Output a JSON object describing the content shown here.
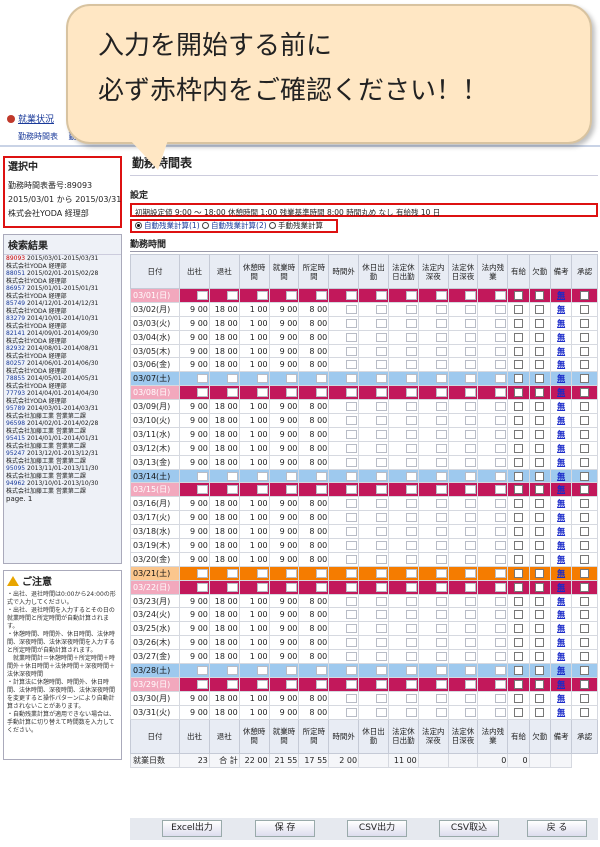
{
  "callout": {
    "line1": "入力を開始する前に",
    "line2": "必ず赤枠内をご確認ください！！"
  },
  "nav": {
    "top_status": "就業状況",
    "breadcrumb": [
      "勤務時間表",
      "勤務予定"
    ]
  },
  "selected": {
    "title": "選択中",
    "number": "勤務時間表番号:89093",
    "period": "2015/03/01 から 2015/03/31",
    "company": "株式会社YODA 経理部"
  },
  "search": {
    "title": "検索結果",
    "page": "page. 1",
    "items": [
      {
        "id": "89093",
        "period": "2015/03/01-2015/03/31",
        "org": "株式会社YODA 経理部",
        "red": true
      },
      {
        "id": "88051",
        "period": "2015/02/01-2015/02/28",
        "org": "株式会社YODA 経理部",
        "red": false
      },
      {
        "id": "86957",
        "period": "2015/01/01-2015/01/31",
        "org": "株式会社YODA 経理部",
        "red": false
      },
      {
        "id": "85749",
        "period": "2014/12/01-2014/12/31",
        "org": "株式会社YODA 経理部",
        "red": false
      },
      {
        "id": "83279",
        "period": "2014/10/01-2014/10/31",
        "org": "株式会社YODA 経理部",
        "red": false
      },
      {
        "id": "82141",
        "period": "2014/09/01-2014/09/30",
        "org": "株式会社YODA 経理部",
        "red": false
      },
      {
        "id": "82932",
        "period": "2014/08/01-2014/08/31",
        "org": "株式会社YODA 経理部",
        "red": false
      },
      {
        "id": "80257",
        "period": "2014/06/01-2014/06/30",
        "org": "株式会社YODA 経理部",
        "red": false
      },
      {
        "id": "78855",
        "period": "2014/05/01-2014/05/31",
        "org": "株式会社YODA 経理部",
        "red": false
      },
      {
        "id": "77793",
        "period": "2014/04/01-2014/04/30",
        "org": "株式会社YODA 経理部",
        "red": false
      },
      {
        "id": "95789",
        "period": "2014/03/01-2014/03/31",
        "org": "株式会社加藤工業 営業第二課",
        "red": false
      },
      {
        "id": "96598",
        "period": "2014/02/01-2014/02/28",
        "org": "株式会社加藤工業 営業第二課",
        "red": false
      },
      {
        "id": "95415",
        "period": "2014/01/01-2014/01/31",
        "org": "株式会社加藤工業 営業第二課",
        "red": false
      },
      {
        "id": "95247",
        "period": "2013/12/01-2013/12/31",
        "org": "株式会社加藤工業 営業第二課",
        "red": false
      },
      {
        "id": "95095",
        "period": "2013/11/01-2013/11/30",
        "org": "株式会社加藤工業 営業第二課",
        "red": false
      },
      {
        "id": "94962",
        "period": "2013/10/01-2013/10/30",
        "org": "株式会社加藤工業 営業第二課",
        "red": false
      }
    ]
  },
  "notice": {
    "title": "ご注意",
    "lines": [
      "・出社、退社時間は0:00から24:00の形式で入力してください。",
      "・出社、退社時間を入力するとその日の就業時間と所定時間が自動計算されます。",
      "・休憩時間、時間外、休日時間、法休時間、深夜時間、法休深夜時間を入力すると所定時間が自動計算されます。",
      "　就業時間計＝休憩時間＋所定時間＋時間外＋休日時間＋法休時間＋深夜時間＋法休深夜時間",
      "・計算法に休憩時間、時間外、休日時間、法休時間、深夜時間、法休深夜時間を変更すると操作パターンにより自動計算されないことがあります。",
      "・自動残業計算が適用できない場合は、手動計算に切り替えて時間数を入力してください。"
    ]
  },
  "page_title": "勤務時間表",
  "settings": {
    "title": "設定",
    "config": "初期設定値  9:00 〜 18:00 休憩時間 1:00 残業基準時間  8:00 時間丸め なし  有給残 10 日",
    "radio1": "自動残業計算(1)",
    "radio2": "自動残業計算(2)",
    "radio3": "手動残業計算"
  },
  "worktime_title": "勤務時間",
  "headers": [
    "日付",
    "出社",
    "退社",
    "休憩時間",
    "就業時間",
    "所定時間",
    "時間外",
    "休日出勤",
    "法定休日出勤",
    "法定内深夜",
    "法定休日深夜",
    "法内残業",
    "有給",
    "欠勤",
    "備考",
    "承認"
  ],
  "remark_label": "無",
  "days": [
    {
      "d": "03/01(日)",
      "t": "sun"
    },
    {
      "d": "03/02(月)",
      "t": "w"
    },
    {
      "d": "03/03(火)",
      "t": "w"
    },
    {
      "d": "03/04(水)",
      "t": "w"
    },
    {
      "d": "03/05(木)",
      "t": "w"
    },
    {
      "d": "03/06(金)",
      "t": "w"
    },
    {
      "d": "03/07(土)",
      "t": "sat"
    },
    {
      "d": "03/08(日)",
      "t": "sun"
    },
    {
      "d": "03/09(月)",
      "t": "w"
    },
    {
      "d": "03/10(火)",
      "t": "w"
    },
    {
      "d": "03/11(水)",
      "t": "w"
    },
    {
      "d": "03/12(木)",
      "t": "w"
    },
    {
      "d": "03/13(金)",
      "t": "w"
    },
    {
      "d": "03/14(土)",
      "t": "sat"
    },
    {
      "d": "03/15(日)",
      "t": "sun"
    },
    {
      "d": "03/16(月)",
      "t": "w"
    },
    {
      "d": "03/17(火)",
      "t": "w"
    },
    {
      "d": "03/18(水)",
      "t": "w"
    },
    {
      "d": "03/19(木)",
      "t": "w"
    },
    {
      "d": "03/20(金)",
      "t": "w"
    },
    {
      "d": "03/21(土)",
      "t": "hol"
    },
    {
      "d": "03/22(日)",
      "t": "sun"
    },
    {
      "d": "03/23(月)",
      "t": "w"
    },
    {
      "d": "03/24(火)",
      "t": "w"
    },
    {
      "d": "03/25(水)",
      "t": "w"
    },
    {
      "d": "03/26(木)",
      "t": "w"
    },
    {
      "d": "03/27(金)",
      "t": "w"
    },
    {
      "d": "03/28(土)",
      "t": "sat"
    },
    {
      "d": "03/29(日)",
      "t": "sun"
    },
    {
      "d": "03/30(月)",
      "t": "w"
    },
    {
      "d": "03/31(火)",
      "t": "w"
    }
  ],
  "weekday_values": {
    "in_h": "9",
    "in_m": "00",
    "out_h": "18",
    "out_m": "00",
    "rest_h": "1",
    "rest_m": "00",
    "work_h": "9",
    "work_m": "00",
    "sched_h": "8",
    "sched_m": "00"
  },
  "footer": {
    "label": "就業日数",
    "days": "23",
    "total_label": "合 計",
    "in_h": "22",
    "in_m": "00",
    "out_h": "21",
    "out_m": "55",
    "rest_h": "17",
    "rest_m": "55",
    "work_h": "2",
    "work_m": "00",
    "ot_h": "11",
    "ot_m": "00",
    "paid": "0",
    "absent": "0"
  },
  "buttons": [
    "Excel出力",
    "保 存",
    "CSV出力",
    "CSV取込",
    "戻 る"
  ]
}
